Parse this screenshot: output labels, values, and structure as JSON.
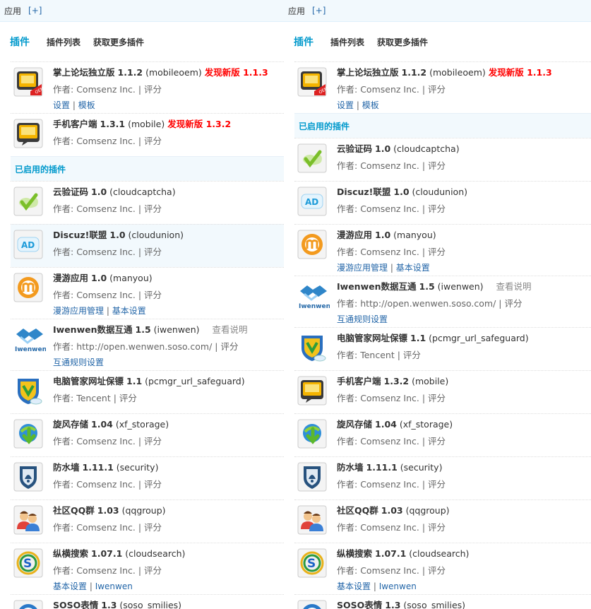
{
  "topbar": {
    "label": "应用",
    "plus": "[+]"
  },
  "subnav": {
    "current": "插件",
    "items": [
      "插件列表",
      "获取更多插件"
    ]
  },
  "section_enabled": "已启用的插件",
  "author_prefix": "作者:",
  "rate": "评分",
  "left": {
    "updates": [
      {
        "icon": "mobileoem",
        "name": "掌上论坛独立版",
        "version": "1.1.2",
        "ident": "(mobileoem)",
        "newv": "发现新版 1.1.3",
        "author": "Comsenz Inc.",
        "links": [
          "设置",
          "模板"
        ]
      },
      {
        "icon": "mobile",
        "name": "手机客户端",
        "version": "1.3.1",
        "ident": "(mobile)",
        "newv": "发现新版 1.3.2",
        "author": "Comsenz Inc.",
        "links": []
      }
    ],
    "enabled": [
      {
        "icon": "cloudcaptcha",
        "name": "云验证码",
        "version": "1.0",
        "ident": "(cloudcaptcha)",
        "author": "Comsenz Inc.",
        "links": []
      },
      {
        "icon": "cloudunion",
        "name": "Discuz!联盟",
        "version": "1.0",
        "ident": "(cloudunion)",
        "author": "Comsenz Inc.",
        "links": [],
        "hl": true
      },
      {
        "icon": "manyou",
        "name": "漫游应用",
        "version": "1.0",
        "ident": "(manyou)",
        "author": "Comsenz Inc.",
        "links": [
          "漫游应用管理",
          "基本设置"
        ]
      },
      {
        "icon": "iwenwen",
        "name": "Iwenwen数据互通",
        "version": "1.5",
        "ident": "(iwenwen)",
        "info": "查看说明",
        "author": "http://open.wenwen.soso.com/",
        "links": [
          "互通规则设置"
        ]
      },
      {
        "icon": "pcmgr",
        "name": "电脑管家网址保镖",
        "version": "1.1",
        "ident": "(pcmgr_url_safeguard)",
        "author": "Tencent",
        "links": []
      },
      {
        "icon": "xfstorage",
        "name": "旋风存储",
        "version": "1.04",
        "ident": "(xf_storage)",
        "author": "Comsenz Inc.",
        "links": []
      },
      {
        "icon": "security",
        "name": "防水墙",
        "version": "1.11.1",
        "ident": "(security)",
        "author": "Comsenz Inc.",
        "links": []
      },
      {
        "icon": "qqgroup",
        "name": "社区QQ群",
        "version": "1.03",
        "ident": "(qqgroup)",
        "author": "Comsenz Inc.",
        "links": []
      },
      {
        "icon": "cloudsearch",
        "name": "纵横搜索",
        "version": "1.07.1",
        "ident": "(cloudsearch)",
        "author": "Comsenz Inc.",
        "links": [
          "基本设置",
          "Iwenwen"
        ]
      },
      {
        "icon": "soso",
        "name": "SOSO表情",
        "version": "1.3",
        "ident": "(soso_smilies)",
        "author": "",
        "links": []
      }
    ]
  },
  "right": {
    "updates": [
      {
        "icon": "mobileoem",
        "name": "掌上论坛独立版",
        "version": "1.1.2",
        "ident": "(mobileoem)",
        "newv": "发现新版 1.1.3",
        "author": "Comsenz Inc.",
        "links": [
          "设置",
          "模板"
        ]
      }
    ],
    "enabled": [
      {
        "icon": "cloudcaptcha",
        "name": "云验证码",
        "version": "1.0",
        "ident": "(cloudcaptcha)",
        "author": "Comsenz Inc.",
        "links": []
      },
      {
        "icon": "cloudunion",
        "name": "Discuz!联盟",
        "version": "1.0",
        "ident": "(cloudunion)",
        "author": "Comsenz Inc.",
        "links": []
      },
      {
        "icon": "manyou",
        "name": "漫游应用",
        "version": "1.0",
        "ident": "(manyou)",
        "author": "Comsenz Inc.",
        "links": [
          "漫游应用管理",
          "基本设置"
        ]
      },
      {
        "icon": "iwenwen",
        "name": "Iwenwen数据互通",
        "version": "1.5",
        "ident": "(iwenwen)",
        "info": "查看说明",
        "author": "http://open.wenwen.soso.com/",
        "links": [
          "互通规则设置"
        ]
      },
      {
        "icon": "pcmgr",
        "name": "电脑管家网址保镖",
        "version": "1.1",
        "ident": "(pcmgr_url_safeguard)",
        "author": "Tencent",
        "links": []
      },
      {
        "icon": "mobile",
        "name": "手机客户端",
        "version": "1.3.2",
        "ident": "(mobile)",
        "author": "Comsenz Inc.",
        "links": []
      },
      {
        "icon": "xfstorage",
        "name": "旋风存储",
        "version": "1.04",
        "ident": "(xf_storage)",
        "author": "Comsenz Inc.",
        "links": []
      },
      {
        "icon": "security",
        "name": "防水墙",
        "version": "1.11.1",
        "ident": "(security)",
        "author": "Comsenz Inc.",
        "links": []
      },
      {
        "icon": "qqgroup",
        "name": "社区QQ群",
        "version": "1.03",
        "ident": "(qqgroup)",
        "author": "Comsenz Inc.",
        "links": []
      },
      {
        "icon": "cloudsearch",
        "name": "纵横搜索",
        "version": "1.07.1",
        "ident": "(cloudsearch)",
        "author": "Comsenz Inc.",
        "links": [
          "基本设置",
          "Iwenwen"
        ]
      },
      {
        "icon": "soso",
        "name": "SOSO表情",
        "version": "1.3",
        "ident": "(soso_smilies)",
        "author": "",
        "links": []
      }
    ]
  }
}
